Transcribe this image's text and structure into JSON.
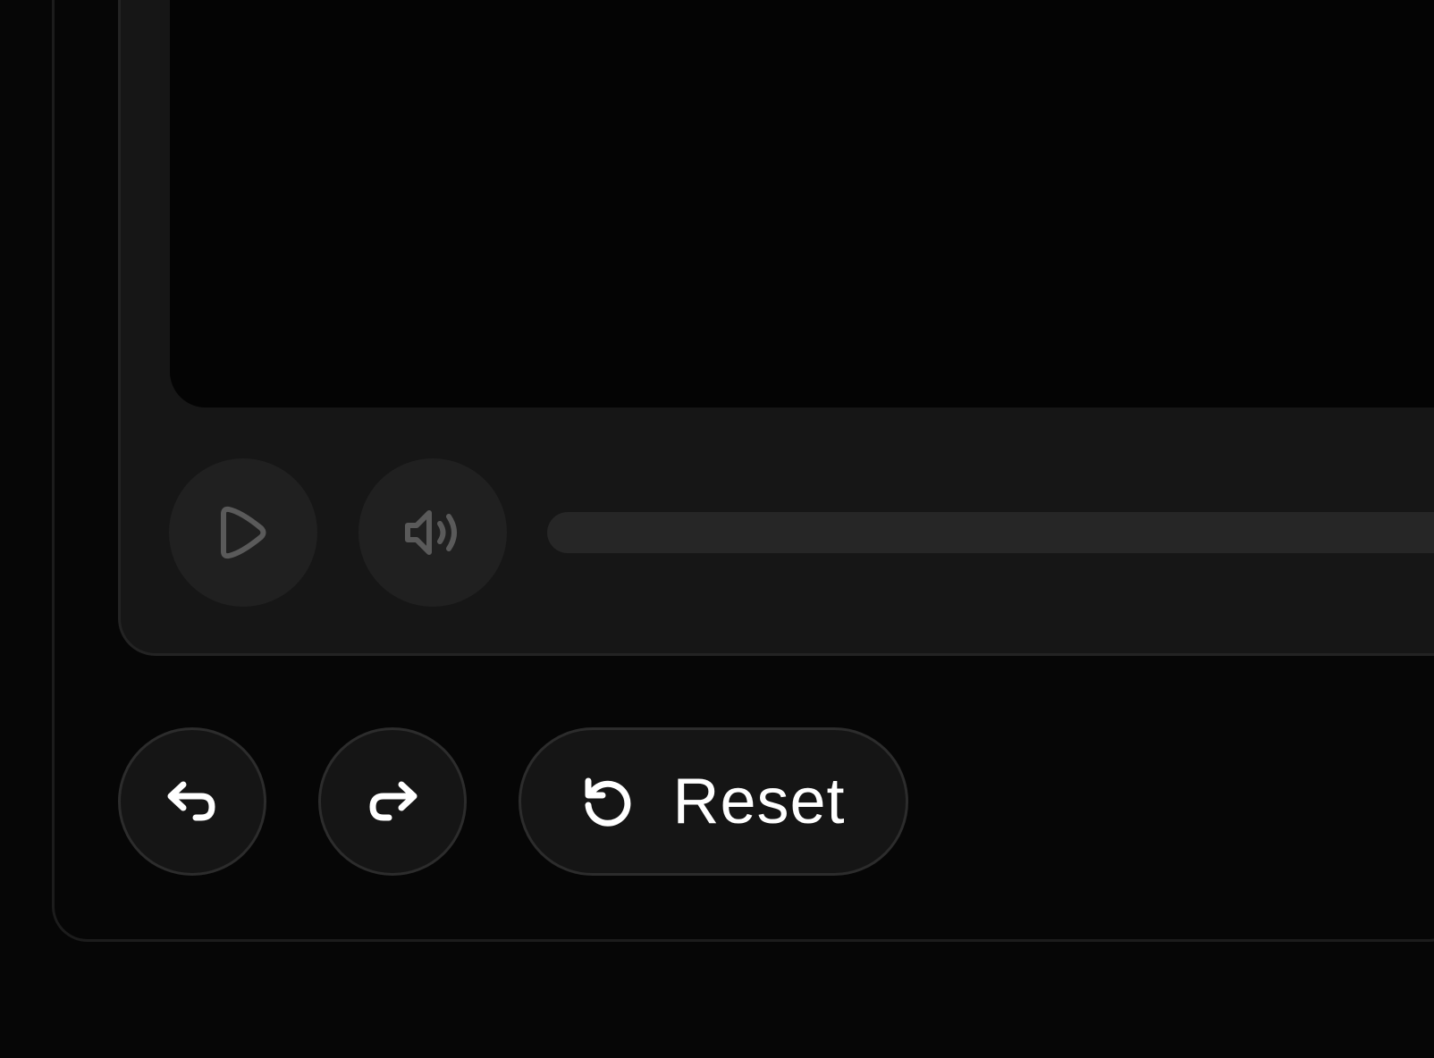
{
  "player": {
    "play_button_icon": "play-icon",
    "volume_button_icon": "volume-icon",
    "progress_fraction": 0
  },
  "actions": {
    "undo_icon": "undo-icon",
    "redo_icon": "redo-icon",
    "reset_icon": "reset-icon",
    "reset_label": "Reset"
  },
  "colors": {
    "background": "#060606",
    "card": "#161616",
    "video": "#040404",
    "disabled_icon": "#5a5a5a",
    "active_icon": "#ffffff"
  }
}
